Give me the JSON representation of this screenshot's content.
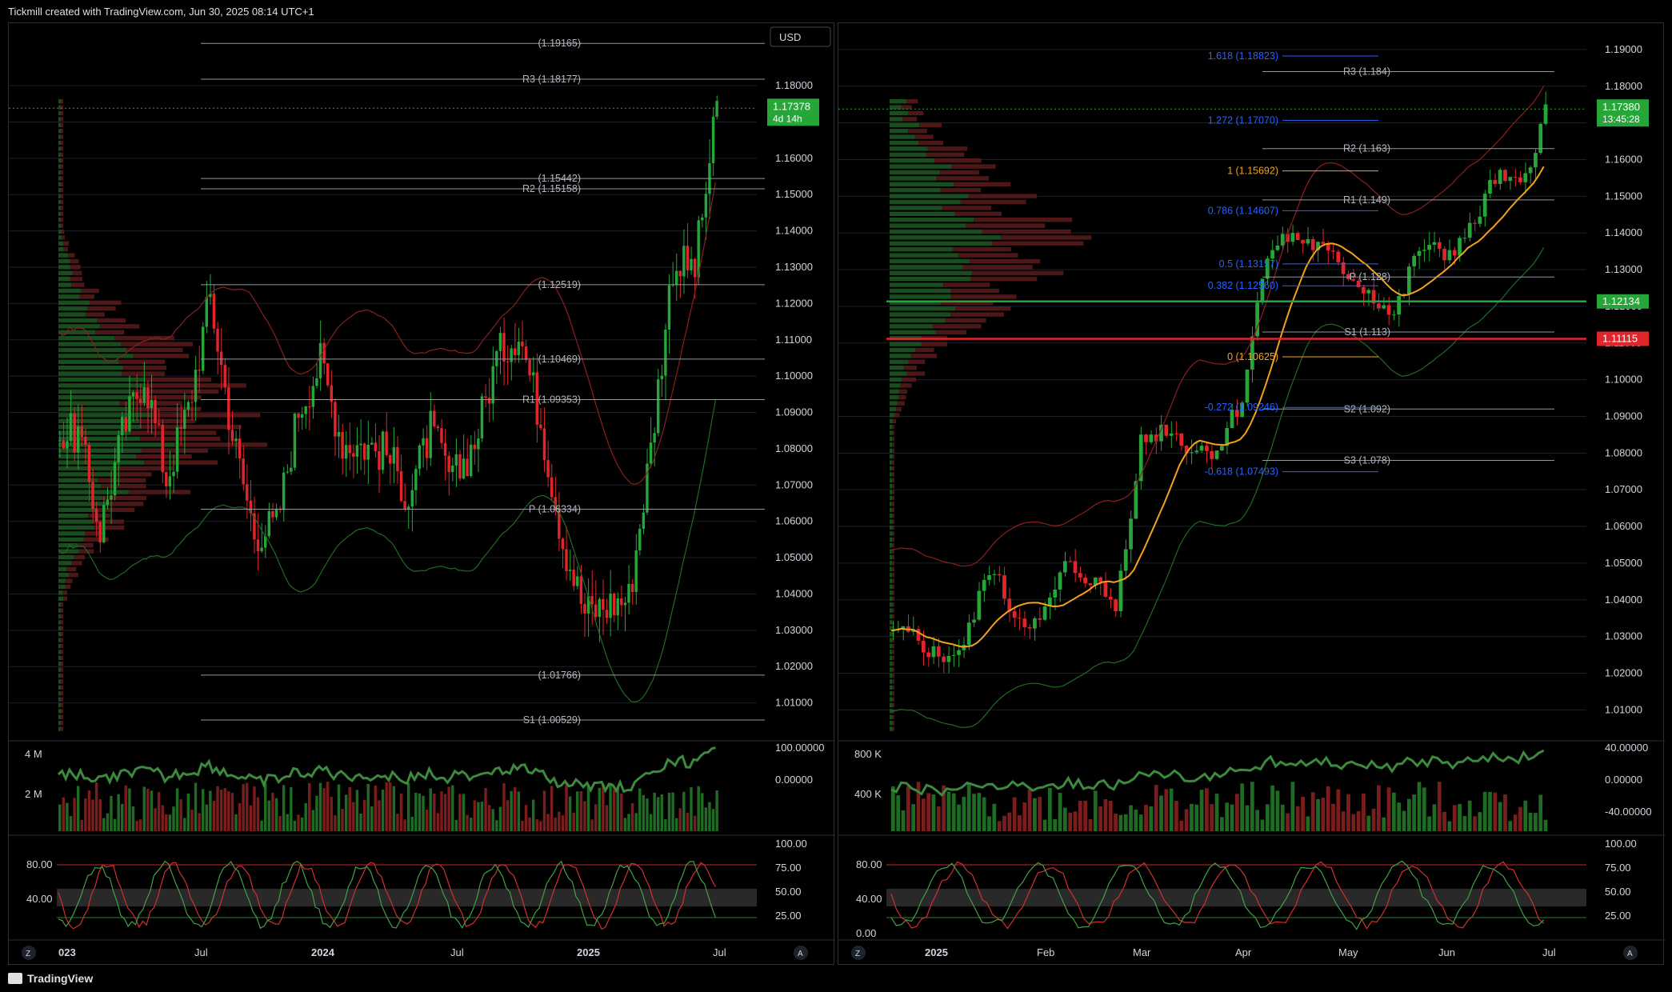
{
  "header": {
    "title": "Tickmill created with TradingView.com, Jun 30, 2025 08:14 UTC+1"
  },
  "footer": {
    "brand": "TradingView"
  },
  "colors": {
    "up": "#26a638",
    "down": "#e0262b",
    "bg": "#000000",
    "grid": "#1c1f26",
    "ema": "#f5a21b",
    "fib": "#2962ff"
  },
  "left": {
    "currency": "USD",
    "ylim": [
      1.0,
      1.195
    ],
    "price_ticks": [
      "1.18000",
      "1.17000",
      "1.16000",
      "1.15000",
      "1.14000",
      "1.13000",
      "1.12000",
      "1.11000",
      "1.10000",
      "1.09000",
      "1.08000",
      "1.07000",
      "1.06000",
      "1.05000",
      "1.04000",
      "1.03000",
      "1.02000",
      "1.01000"
    ],
    "last_price": "1.17378",
    "countdown": "4d 14h",
    "time_labels": [
      "023",
      "Jul",
      "2024",
      "Jul",
      "2025",
      "Jul"
    ],
    "levels": [
      {
        "label": "(1.19165)",
        "price": 1.19165
      },
      {
        "label": "R3 (1.18177)",
        "price": 1.18177
      },
      {
        "label": "(1.15442)",
        "price": 1.15442
      },
      {
        "label": "R2 (1.15158)",
        "price": 1.15158
      },
      {
        "label": "(1.12519)",
        "price": 1.12519
      },
      {
        "label": "(1.10469)",
        "price": 1.10469
      },
      {
        "label": "R1 (1.09353)",
        "price": 1.09353
      },
      {
        "label": "P (1.06334)",
        "price": 1.06334
      },
      {
        "label": "(1.01766)",
        "price": 1.01766
      },
      {
        "label": "S1 (1.00529)",
        "price": 1.00529
      }
    ],
    "osc_ticks": [
      "100.00000",
      "0.00000"
    ],
    "vol_ticks": [
      "4 M",
      "2 M"
    ],
    "stoch_ticks_left": [
      "80.00",
      "40.00"
    ],
    "stoch_ticks_right": [
      "100.00",
      "75.00",
      "50.00",
      "25.00"
    ],
    "scale_buttons": [
      "Z",
      "A"
    ]
  },
  "right": {
    "ylim": [
      1.002,
      1.195
    ],
    "price_ticks": [
      "1.19000",
      "1.18000",
      "1.17000",
      "1.16000",
      "1.15000",
      "1.14000",
      "1.13000",
      "1.12000",
      "1.11000",
      "1.10000",
      "1.09000",
      "1.08000",
      "1.07000",
      "1.06000",
      "1.05000",
      "1.04000",
      "1.03000",
      "1.02000",
      "1.01000"
    ],
    "last_price": "1.17380",
    "countdown": "13:45:28",
    "green_level": "1.12134",
    "red_level": "1.11115",
    "time_labels": [
      "2025",
      "Feb",
      "Mar",
      "Apr",
      "May",
      "Jun",
      "Jul"
    ],
    "fib_levels": [
      {
        "label": "1.618 (1.18823)",
        "price": 1.18823
      },
      {
        "label": "1.272 (1.17070)",
        "price": 1.1707
      },
      {
        "label": "1 (1.15692)",
        "price": 1.15692
      },
      {
        "label": "0.786 (1.14607)",
        "price": 1.14607
      },
      {
        "label": "0.5 (1.13157)",
        "price": 1.13157
      },
      {
        "label": "0.382 (1.12560)",
        "price": 1.1256
      },
      {
        "label": "0 (1.10625)",
        "price": 1.10625
      },
      {
        "label": "-0.272 (1.09246)",
        "price": 1.09246
      },
      {
        "label": "-0.618 (1.07493)",
        "price": 1.07493
      }
    ],
    "pivots": [
      {
        "label": "R3 (1.184)",
        "price": 1.184
      },
      {
        "label": "R2 (1.163)",
        "price": 1.163
      },
      {
        "label": "R1 (1.149)",
        "price": 1.149
      },
      {
        "label": "P (1.128)",
        "price": 1.128
      },
      {
        "label": "S1 (1.113)",
        "price": 1.113
      },
      {
        "label": "S2 (1.092)",
        "price": 1.092
      },
      {
        "label": "S3 (1.078)",
        "price": 1.078
      }
    ],
    "osc_ticks": [
      "40.00000",
      "0.00000",
      "-40.00000"
    ],
    "vol_ticks": [
      "800 K",
      "400 K"
    ],
    "stoch_ticks_left": [
      "80.00",
      "40.00",
      "0.00"
    ],
    "stoch_ticks_right": [
      "100.00",
      "75.00",
      "50.00",
      "25.00"
    ],
    "scale_buttons": [
      "Z",
      "A"
    ]
  },
  "chart_data": [
    {
      "type": "candlestick",
      "title": "",
      "panel": "left",
      "xlabel": "",
      "ylabel": "",
      "x": [
        "2023-01",
        "2023-02",
        "2023-03",
        "2023-04",
        "2023-05",
        "2023-06",
        "2023-07",
        "2023-08",
        "2023-09",
        "2023-10",
        "2023-11",
        "2023-12",
        "2024-01",
        "2024-02",
        "2024-03",
        "2024-04",
        "2024-05",
        "2024-06",
        "2024-07",
        "2024-08",
        "2024-09",
        "2024-10",
        "2024-11",
        "2024-12",
        "2025-01",
        "2025-02",
        "2025-03",
        "2025-04",
        "2025-05",
        "2025-06"
      ],
      "close": [
        1.084,
        1.058,
        1.084,
        1.101,
        1.072,
        1.091,
        1.122,
        1.084,
        1.057,
        1.059,
        1.091,
        1.104,
        1.082,
        1.081,
        1.079,
        1.067,
        1.085,
        1.071,
        1.082,
        1.105,
        1.113,
        1.088,
        1.055,
        1.035,
        1.037,
        1.039,
        1.08,
        1.131,
        1.13,
        1.173
      ],
      "ylim": [
        1.0,
        1.195
      ]
    },
    {
      "type": "candlestick",
      "title": "",
      "panel": "right",
      "xlabel": "",
      "ylabel": "",
      "x": [
        "2025-01-03",
        "2025-01-10",
        "2025-01-17",
        "2025-01-24",
        "2025-01-31",
        "2025-02-07",
        "2025-02-14",
        "2025-02-21",
        "2025-02-28",
        "2025-03-07",
        "2025-03-14",
        "2025-03-21",
        "2025-03-28",
        "2025-04-04",
        "2025-04-11",
        "2025-04-18",
        "2025-04-25",
        "2025-05-02",
        "2025-05-09",
        "2025-05-16",
        "2025-05-23",
        "2025-05-30",
        "2025-06-06",
        "2025-06-13",
        "2025-06-20",
        "2025-06-27"
      ],
      "close": [
        1.03,
        1.024,
        1.027,
        1.049,
        1.036,
        1.033,
        1.049,
        1.046,
        1.038,
        1.083,
        1.087,
        1.081,
        1.081,
        1.095,
        1.136,
        1.139,
        1.136,
        1.13,
        1.124,
        1.117,
        1.136,
        1.134,
        1.14,
        1.155,
        1.152,
        1.173
      ],
      "ylim": [
        1.002,
        1.195
      ]
    }
  ]
}
